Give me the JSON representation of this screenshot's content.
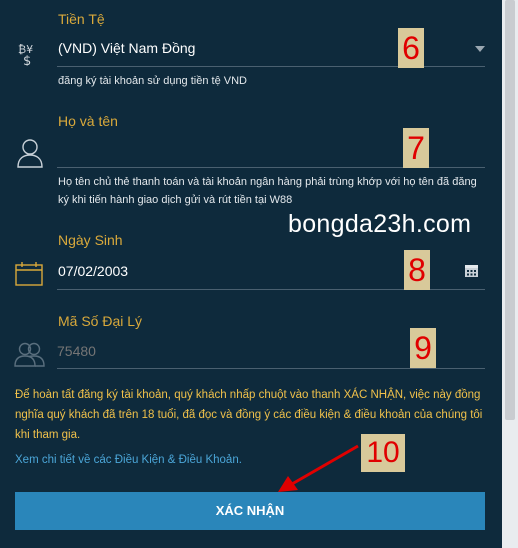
{
  "currency": {
    "label": "Tiền Tệ",
    "value": "(VND) Việt Nam Đồng",
    "helper": "đăng ký tài khoản sử dụng tiền tệ VND",
    "step": "6"
  },
  "fullname": {
    "label": "Họ và tên",
    "value": "",
    "helper": "Họ tên chủ thẻ thanh toán và tài khoản ngân hàng phải trùng khớp với họ tên đã đăng ký khi tiến hành giao dịch gửi và rút tiền tại W88",
    "step": "7"
  },
  "watermark": "bongda23h.com",
  "birthdate": {
    "label": "Ngày Sinh",
    "value": "07/02/2003",
    "step": "8"
  },
  "agent_code": {
    "label": "Mã Số Đại Lý",
    "placeholder": "75480",
    "step": "9"
  },
  "consent_text": "Để hoàn tất đăng ký tài khoản, quý khách nhấp chuột vào thanh XÁC NHẬN, việc này đồng nghĩa quý khách đã trên 18 tuổi, đã đọc và đồng ý các điều kiện & điều khoản của chúng tôi khi tham gia.",
  "terms_link": "Xem chi tiết về các Điều Kiện & Điều Khoản.",
  "submit": {
    "label": "XÁC NHẬN",
    "step": "10"
  },
  "colors": {
    "background": "#0e2a3c",
    "label": "#d9a93b",
    "consent": "#f0c14b",
    "link": "#4ba6d8",
    "button": "#2a86ba",
    "step_marker": "#e00000"
  },
  "icons": [
    "currency-icon",
    "dropdown-caret-icon",
    "user-icon",
    "calendar-icon",
    "calendar-picker-icon",
    "agents-icon",
    "arrow-annotation"
  ]
}
